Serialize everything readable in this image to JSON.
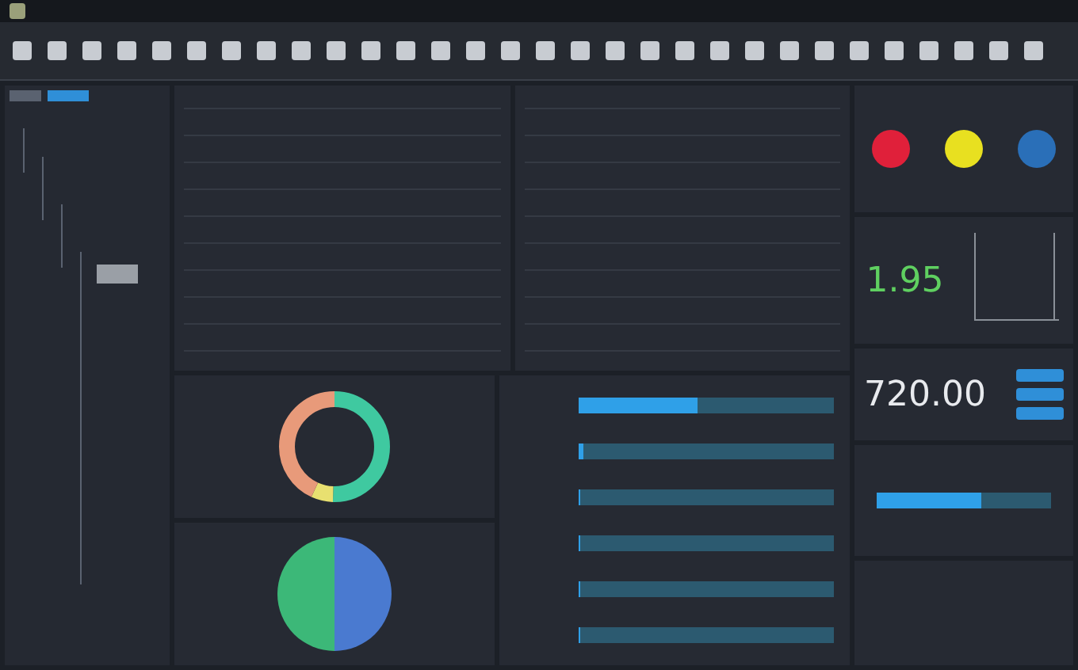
{
  "status_lights": [
    {
      "color": "#e0203a"
    },
    {
      "color": "#e8e020"
    },
    {
      "color": "#2a6fb8"
    }
  ],
  "readout": {
    "value": "1.95"
  },
  "meters": [
    {
      "level": 0.47
    },
    {
      "level": 0.02
    },
    {
      "level": 0.01
    },
    {
      "level": 0.01
    },
    {
      "level": 0.01
    },
    {
      "level": 0.01
    }
  ],
  "total": {
    "value": "720.00"
  },
  "progress": {
    "level": 0.6
  }
}
